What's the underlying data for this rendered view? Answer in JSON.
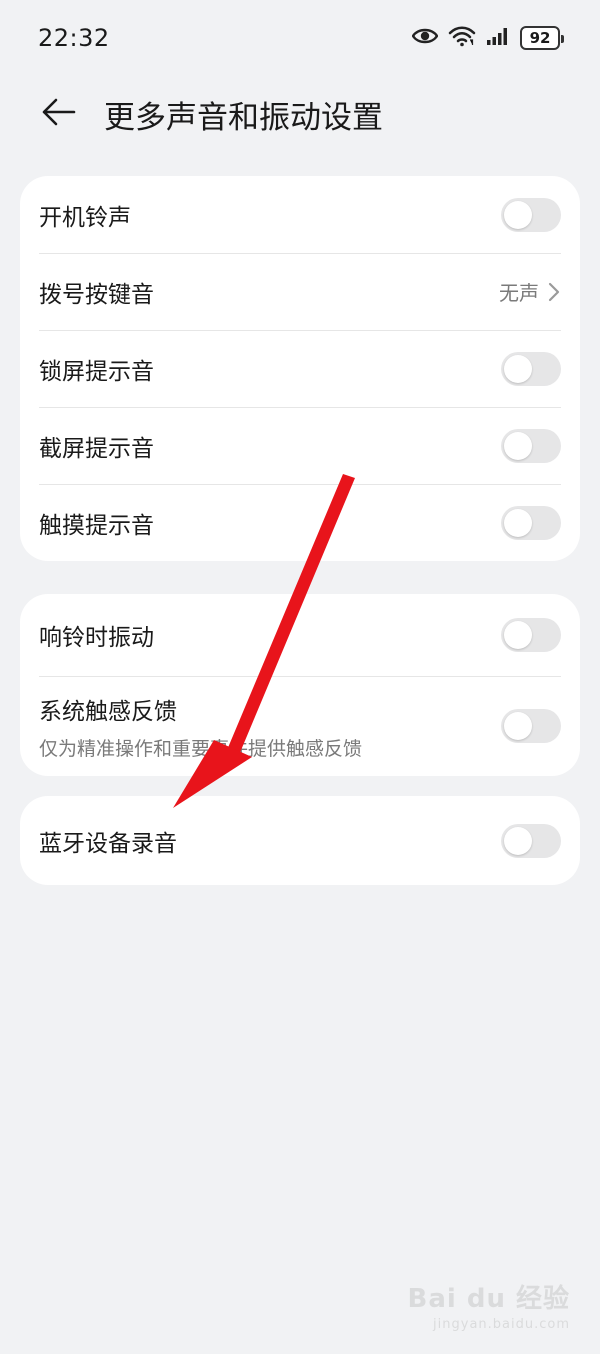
{
  "status_bar": {
    "time": "22:32",
    "battery": "92",
    "icons": [
      "eye-icon",
      "wifi-icon",
      "signal-icon",
      "battery-icon"
    ]
  },
  "header": {
    "title": "更多声音和振动设置"
  },
  "group1": {
    "items": [
      {
        "label": "开机铃声",
        "control": "toggle",
        "state": "off"
      },
      {
        "label": "拨号按键音",
        "control": "value",
        "value": "无声"
      },
      {
        "label": "锁屏提示音",
        "control": "toggle",
        "state": "off"
      },
      {
        "label": "截屏提示音",
        "control": "toggle",
        "state": "off"
      },
      {
        "label": "触摸提示音",
        "control": "toggle",
        "state": "off"
      }
    ]
  },
  "group2": {
    "items": [
      {
        "label": "响铃时振动",
        "control": "toggle",
        "state": "off"
      },
      {
        "label": "系统触感反馈",
        "sublabel": "仅为精准操作和重要事件提供触感反馈",
        "control": "toggle",
        "state": "off"
      }
    ]
  },
  "group3": {
    "items": [
      {
        "label": "蓝牙设备录音",
        "control": "toggle",
        "state": "off"
      }
    ]
  },
  "colors": {
    "background": "#f1f2f4",
    "card": "#ffffff",
    "toggle_off": "#e6e6e7",
    "annotation_arrow": "#e8141b",
    "secondary_text": "#7a7a7a"
  },
  "watermark": {
    "main": "Bai du 经验",
    "sub": "jingyan.baidu.com"
  }
}
